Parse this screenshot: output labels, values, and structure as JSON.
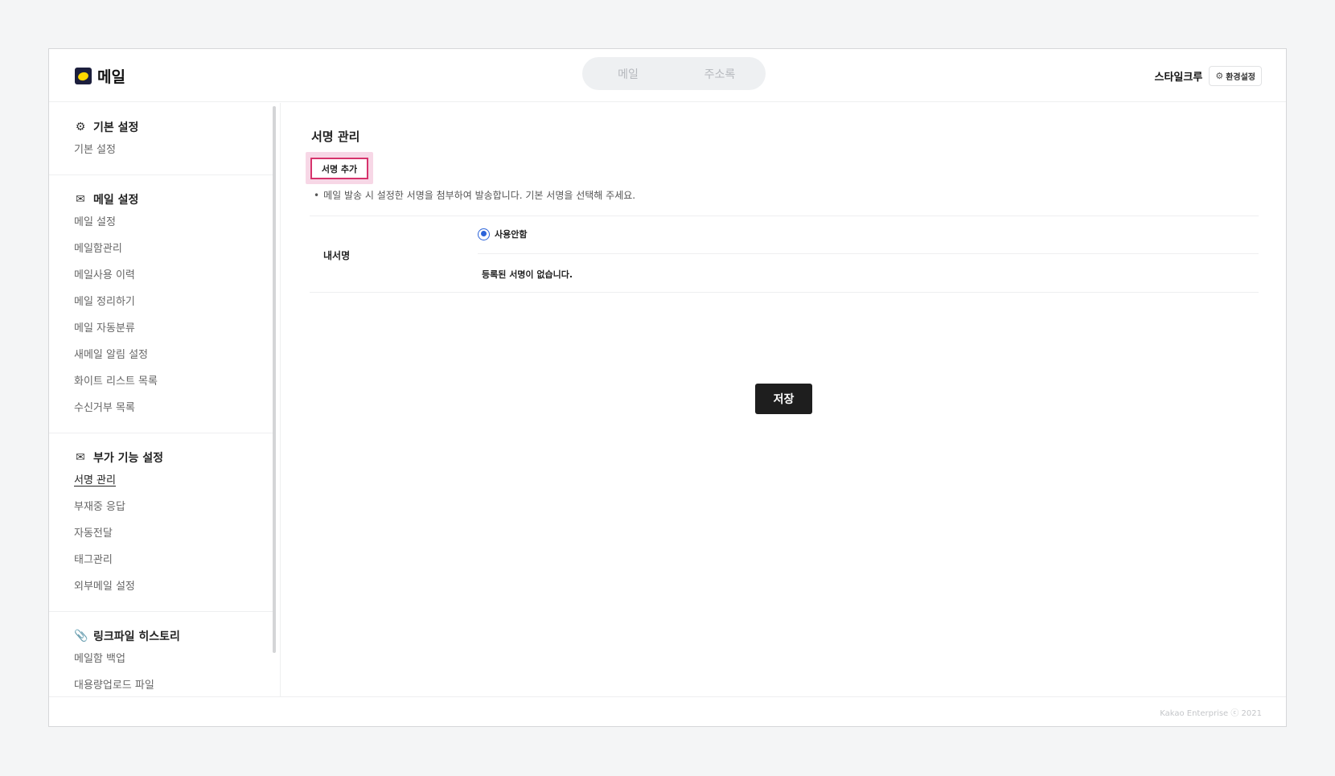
{
  "header": {
    "app_title": "메일",
    "tabs": [
      {
        "label": "메일"
      },
      {
        "label": "주소록"
      }
    ],
    "user_name": "스타일크루",
    "settings_label": "환경설정"
  },
  "sidebar": {
    "sections": [
      {
        "title": "기본 설정",
        "icon": "gear-icon",
        "items": [
          "기본 설정"
        ]
      },
      {
        "title": "메일 설정",
        "icon": "mail-settings-icon",
        "items": [
          "메일 설정",
          "메일함관리",
          "메일사용 이력",
          "메일 정리하기",
          "메일 자동분류",
          "새메일 알림 설정",
          "화이트 리스트 목록",
          "수신거부 목록"
        ]
      },
      {
        "title": "부가 기능 설정",
        "icon": "mail-plus-icon",
        "items": [
          "서명 관리",
          "부재중 응답",
          "자동전달",
          "태그관리",
          "외부메일 설정"
        ]
      },
      {
        "title": "링크파일 히스토리",
        "icon": "paperclip-icon",
        "items": [
          "메일함 백업",
          "대용량업로드 파일"
        ]
      }
    ],
    "active_item": "서명 관리"
  },
  "main": {
    "page_title": "서명 관리",
    "add_button": "서명 추가",
    "notice": "메일 발송 시 설정한 서명을 첨부하여 발송합니다. 기본 서명을 선택해 주세요.",
    "table": {
      "label": "내서명",
      "radio_label": "사용안함",
      "radio_checked": true,
      "empty_message": "등록된 서명이 없습니다."
    },
    "save_button": "저장"
  },
  "footer": {
    "copyright": "Kakao Enterprise ⓒ 2021"
  },
  "colors": {
    "accent_highlight": "#f7d7e6",
    "accent_border": "#d6336c",
    "radio": "#2b63d9",
    "primary_button": "#1e1e1e"
  }
}
